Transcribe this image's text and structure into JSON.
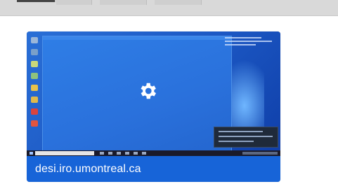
{
  "card": {
    "caption": "desi.iro.umontreal.ca"
  },
  "colors": {
    "card_blue": "#1764d8",
    "desktop_blue": "#2a71dc",
    "top_strip": "#d9d9d9"
  },
  "icons": {
    "settings": "gear-icon"
  }
}
